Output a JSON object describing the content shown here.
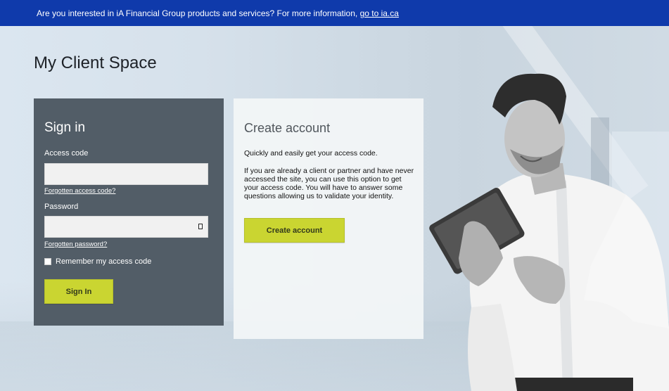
{
  "banner": {
    "message": "Are you interested in iA Financial Group products and services? For more information,",
    "link_label": "go to ia.ca"
  },
  "page": {
    "title": "My Client Space"
  },
  "signin": {
    "heading": "Sign in",
    "access_code_label": "Access code",
    "access_code_value": "",
    "forgot_access_code": "Forgotten access code?",
    "password_label": "Password",
    "password_value": "",
    "forgot_password": "Forgotten password?",
    "remember_label": "Remember my access code",
    "remember_checked": false,
    "submit_label": "Sign In"
  },
  "create_account": {
    "heading": "Create account",
    "intro": "Quickly and easily get your access code.",
    "description": "If you are already a client or partner and have never accessed the site, you can use this option to get your access code. You will have to answer some questions allowing us to validate your identity.",
    "button_label": "Create account"
  },
  "colors": {
    "banner_bg": "#0f3aab",
    "signin_panel_bg": "#525d67",
    "accent_lime": "#cad531",
    "create_panel_bg": "#f2f5f7"
  },
  "hero_image": {
    "description": "Smiling man in white shirt holding a tablet"
  }
}
